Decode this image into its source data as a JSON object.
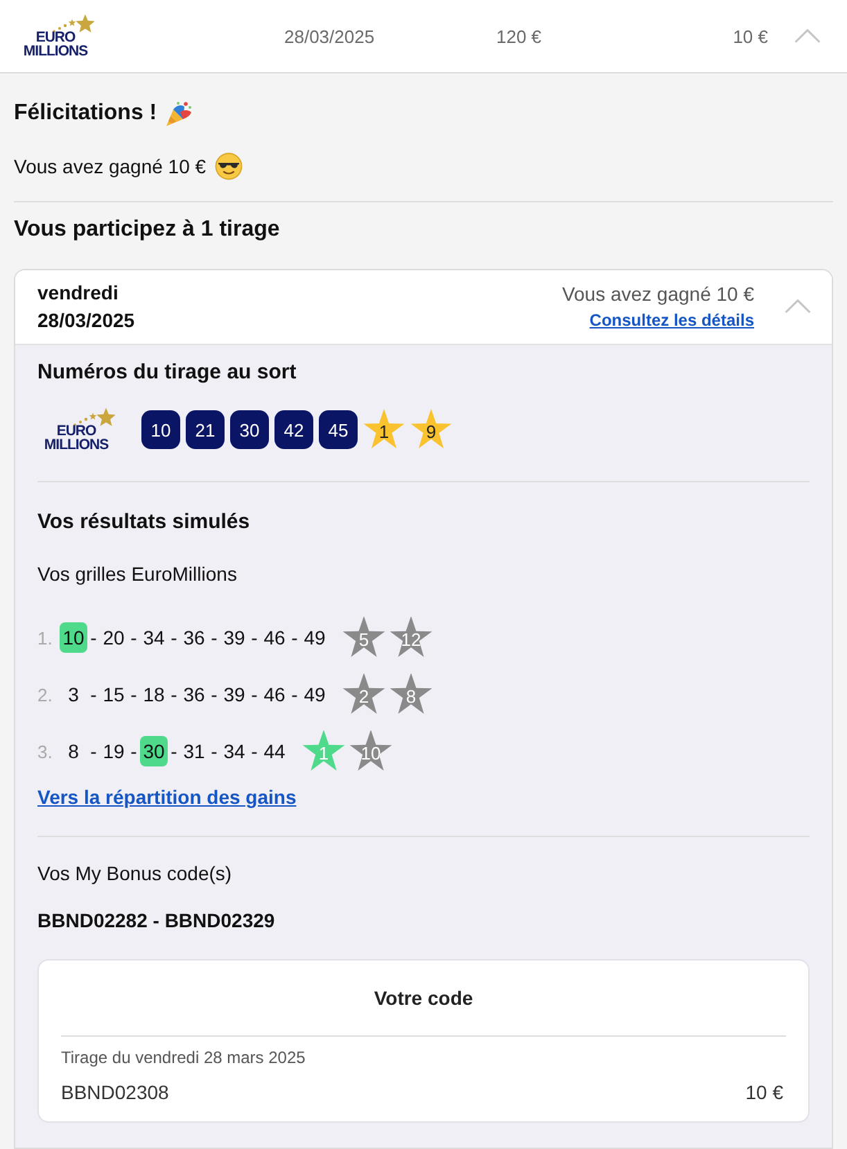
{
  "header": {
    "logo": [
      "EURO",
      "MILLIONS"
    ],
    "date": "28/03/2025",
    "stake": "120 €",
    "winnings": "10 €",
    "expanded": true
  },
  "congrats": {
    "title": "Félicitations !",
    "message": "Vous avez gagné 10 €"
  },
  "draws_heading": "Vous participez à 1 tirage",
  "draw_card": {
    "day": "vendredi",
    "date": "28/03/2025",
    "result": "Vous avez gagné 10 €",
    "details_link": "Consultez les détails",
    "expanded": true,
    "draw_numbers": {
      "title": "Numéros du tirage au sort",
      "logo": [
        "EURO",
        "MILLIONS"
      ],
      "numbers": [
        "10",
        "21",
        "30",
        "42",
        "45"
      ],
      "stars": [
        "1",
        "9"
      ]
    },
    "results": {
      "title": "Vos résultats simulés",
      "subtitle": "Vos grilles EuroMillions",
      "separator": "-",
      "grids": [
        {
          "index": "1.",
          "numbers": [
            {
              "value": "10",
              "matched": true
            },
            {
              "value": "20",
              "matched": false
            },
            {
              "value": "34",
              "matched": false
            },
            {
              "value": "36",
              "matched": false
            },
            {
              "value": "39",
              "matched": false
            },
            {
              "value": "46",
              "matched": false
            },
            {
              "value": "49",
              "matched": false
            }
          ],
          "stars": [
            {
              "value": "5",
              "matched": false
            },
            {
              "value": "12",
              "matched": false
            }
          ]
        },
        {
          "index": "2.",
          "numbers": [
            {
              "value": "3",
              "matched": false
            },
            {
              "value": "15",
              "matched": false
            },
            {
              "value": "18",
              "matched": false
            },
            {
              "value": "36",
              "matched": false
            },
            {
              "value": "39",
              "matched": false
            },
            {
              "value": "46",
              "matched": false
            },
            {
              "value": "49",
              "matched": false
            }
          ],
          "stars": [
            {
              "value": "2",
              "matched": false
            },
            {
              "value": "8",
              "matched": false
            }
          ]
        },
        {
          "index": "3.",
          "numbers": [
            {
              "value": "8",
              "matched": false
            },
            {
              "value": "19",
              "matched": false
            },
            {
              "value": "30",
              "matched": true
            },
            {
              "value": "31",
              "matched": false
            },
            {
              "value": "34",
              "matched": false
            },
            {
              "value": "44",
              "matched": false
            }
          ],
          "stars": [
            {
              "value": "1",
              "matched": true
            },
            {
              "value": "10",
              "matched": false
            }
          ]
        }
      ],
      "link": "Vers la répartition des gains"
    },
    "bonus": {
      "title": "Vos My Bonus code(s)",
      "range": "BBND02282 - BBND02329",
      "code_card": {
        "title": "Votre code",
        "draw_label": "Tirage du vendredi 28 mars 2025",
        "code": "BBND02308",
        "amount": "10 €"
      }
    }
  }
}
